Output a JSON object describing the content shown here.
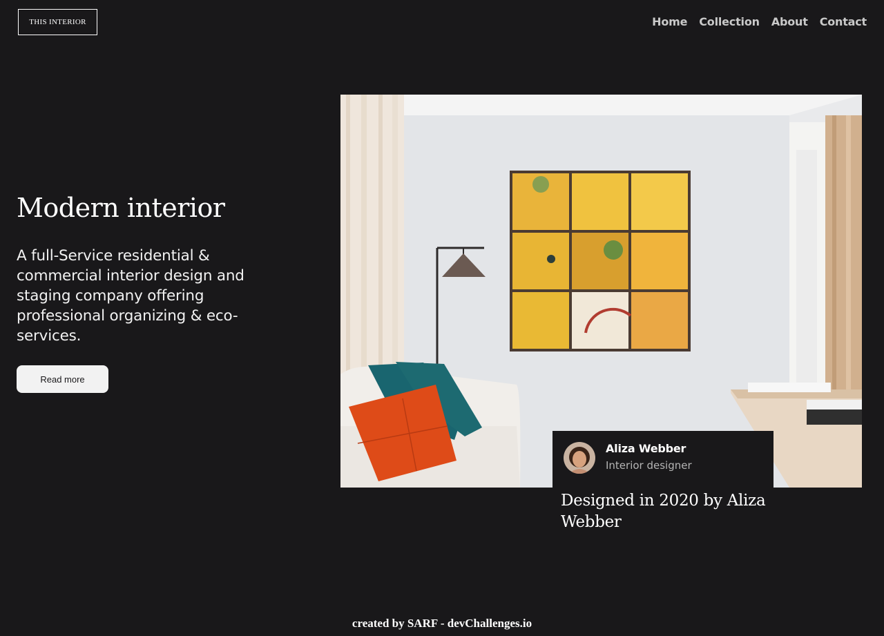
{
  "brand": {
    "logo_text": "THIS INTERIOR"
  },
  "nav": {
    "items": [
      "Home",
      "Collection",
      "About",
      "Contact"
    ]
  },
  "hero": {
    "title": "Modern interior",
    "description": "A full-Service residential & commercial interior design and staging company offering professional organizing & eco-services.",
    "button_label": "Read more"
  },
  "designer": {
    "name": "Aliza Webber",
    "role": "Interior designer"
  },
  "caption": "Designed in 2020 by Aliza Webber",
  "footer": {
    "credit": "created by SARF - devChallenges.io"
  },
  "colors": {
    "background": "#19181a",
    "text": "#ffffff",
    "button_bg": "#f2f2f2"
  }
}
